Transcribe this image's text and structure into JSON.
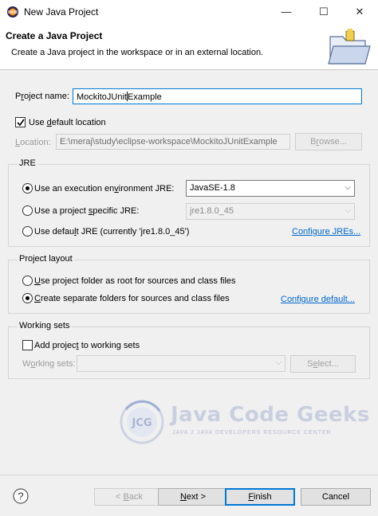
{
  "window": {
    "title": "New Java Project",
    "minimize_glyph": "—",
    "maximize_glyph": "☐",
    "close_glyph": "✕"
  },
  "banner": {
    "heading": "Create a Java Project",
    "description": "Create a Java project in the workspace or in an external location."
  },
  "project": {
    "name_label_prefix": "P",
    "name_label_underlined": "r",
    "name_label_suffix": "oject name:",
    "name_value_before_caret": "MockitoJUnit",
    "name_value_after_caret": "Example",
    "use_default_prefix": "Use ",
    "use_default_underlined": "d",
    "use_default_suffix": "efault location",
    "use_default_checked": true,
    "location_label_underlined": "L",
    "location_label_suffix": "ocation:",
    "location_value": "E:\\meraj\\study\\eclipse-workspace\\MockitoJUnitExample",
    "browse_label_prefix": "B",
    "browse_label_underlined": "r",
    "browse_label_suffix": "owse..."
  },
  "jre": {
    "group_title": "JRE",
    "option_env_prefix": "Use an execution en",
    "option_env_underlined": "v",
    "option_env_suffix": "ironment JRE:",
    "env_selected": "JavaSE-1.8",
    "option_specific_prefix": "Use a project ",
    "option_specific_underlined": "s",
    "option_specific_suffix": "pecific JRE:",
    "specific_selected": "jre1.8.0_45",
    "option_default_prefix": "Use defau",
    "option_default_underlined": "l",
    "option_default_suffix": "t JRE (currently 'jre1.8.0_45')",
    "configure_jres": "Configure JREs...",
    "selected_option": "env"
  },
  "layout": {
    "group_title": "Project layout",
    "option_root_underlined": "U",
    "option_root_suffix": "se project folder as root for sources and class files",
    "option_separate_underlined": "C",
    "option_separate_suffix": "reate separate folders for sources and class files",
    "configure_default": "Configure default...",
    "selected_option": "separate"
  },
  "working_sets": {
    "group_title": "Working sets",
    "add_prefix": "Add projec",
    "add_underlined": "t",
    "add_suffix": " to working sets",
    "add_checked": false,
    "label_prefix": "W",
    "label_underlined": "o",
    "label_suffix": "rking sets:",
    "select_prefix": "S",
    "select_underlined": "e",
    "select_suffix": "lect..."
  },
  "watermark": {
    "wordmark": "Java Code Geeks",
    "tagline": "JAVA 2 JAVA DEVELOPERS RESOURCE CENTER",
    "mark_text": "JCG"
  },
  "footer": {
    "help_glyph": "?",
    "back_prefix": "< ",
    "back_underlined": "B",
    "back_suffix": "ack",
    "next_underlined": "N",
    "next_suffix": "ext >",
    "finish_underlined": "F",
    "finish_suffix": "inish",
    "cancel_label": "Cancel"
  },
  "colors": {
    "accent": "#0078d7",
    "link": "#0066cc"
  }
}
